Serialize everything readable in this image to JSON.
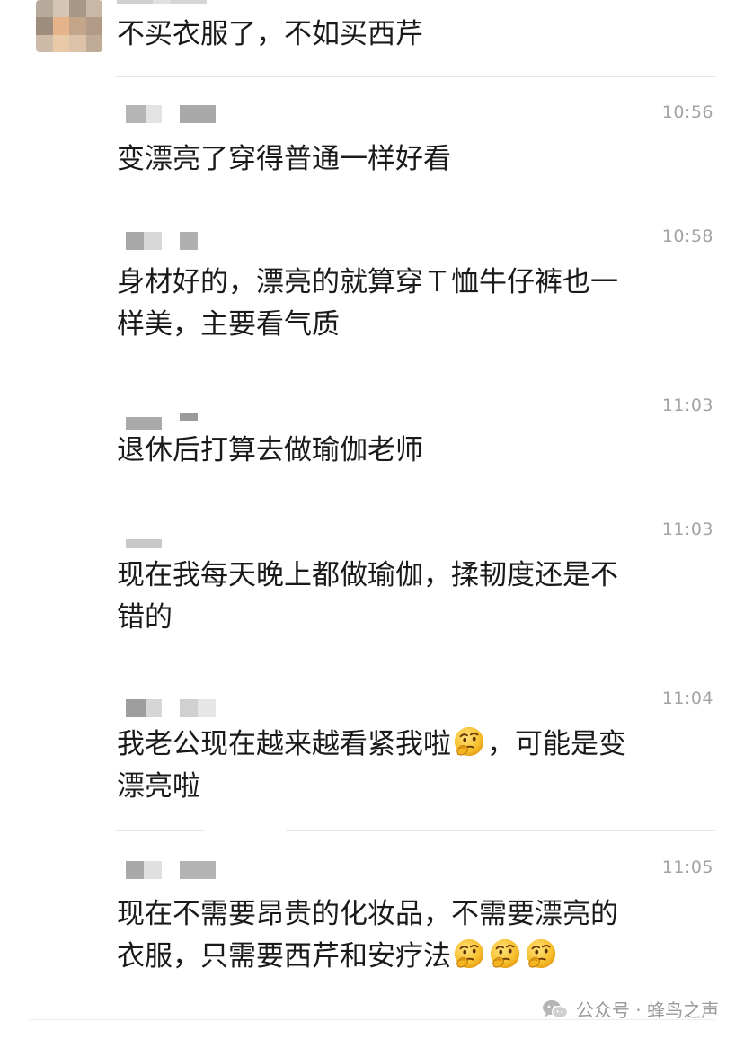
{
  "messages": [
    {
      "text": "不买衣服了，不如买西芹"
    },
    {
      "time": "10:56",
      "text": "变漂亮了穿得普通一样好看"
    },
    {
      "time": "10:58",
      "line1": "身材好的，漂亮的就算穿Ｔ恤牛仔裤也一",
      "line2": "样美，主要看气质"
    },
    {
      "time": "11:03",
      "text": "退休后打算去做瑜伽老师"
    },
    {
      "time": "11:03",
      "line1": "现在我每天晚上都做瑜伽，揉韧度还是不",
      "line2": "错的"
    },
    {
      "time": "11:04",
      "line1a": "我老公现在越来越看紧我啦",
      "line1b": "，可能是变",
      "line2": "漂亮啦",
      "emoji": "thinking-face-icon"
    },
    {
      "time": "11:05",
      "line1": "现在不需要昂贵的化妆品，不需要漂亮的",
      "line2": "衣服，只需要西芹和安疗法",
      "emoji": "thinking-face-icon"
    }
  ],
  "footer": {
    "label": "公众号 · 蜂鸟之声",
    "icon": "wechat-icon"
  },
  "colors": {
    "text": "#1a1a1a",
    "time": "#a3a3a3",
    "divider": "#e6e6e6",
    "blur": "#c8c8c8"
  }
}
